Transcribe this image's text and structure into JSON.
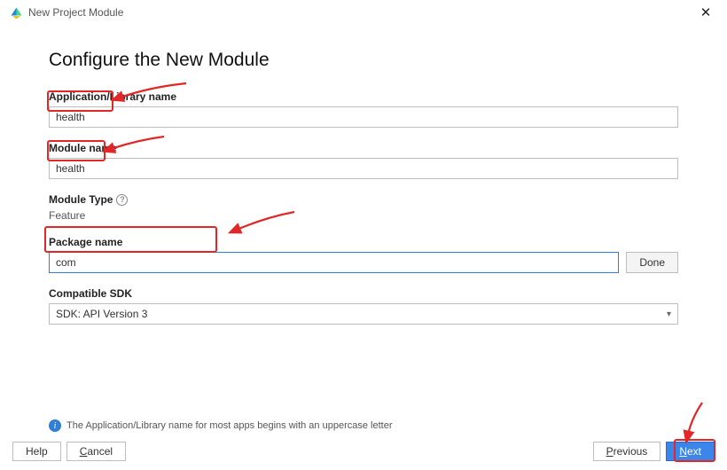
{
  "window": {
    "title": "New Project Module"
  },
  "heading": "Configure the New Module",
  "fields": {
    "appName": {
      "label": "Application/Library name",
      "value": "health"
    },
    "moduleName": {
      "label": "Module name",
      "value": "health"
    },
    "moduleType": {
      "label": "Module Type",
      "value": "Feature"
    },
    "packageName": {
      "label": "Package name",
      "value": "com",
      "doneLabel": "Done"
    },
    "sdk": {
      "label": "Compatible SDK",
      "value": "SDK: API Version 3"
    }
  },
  "info": "The Application/Library name for most apps begins with an uppercase letter",
  "buttons": {
    "help": "Help",
    "cancel": "Cancel",
    "previous": "Previous",
    "next": "Next"
  }
}
